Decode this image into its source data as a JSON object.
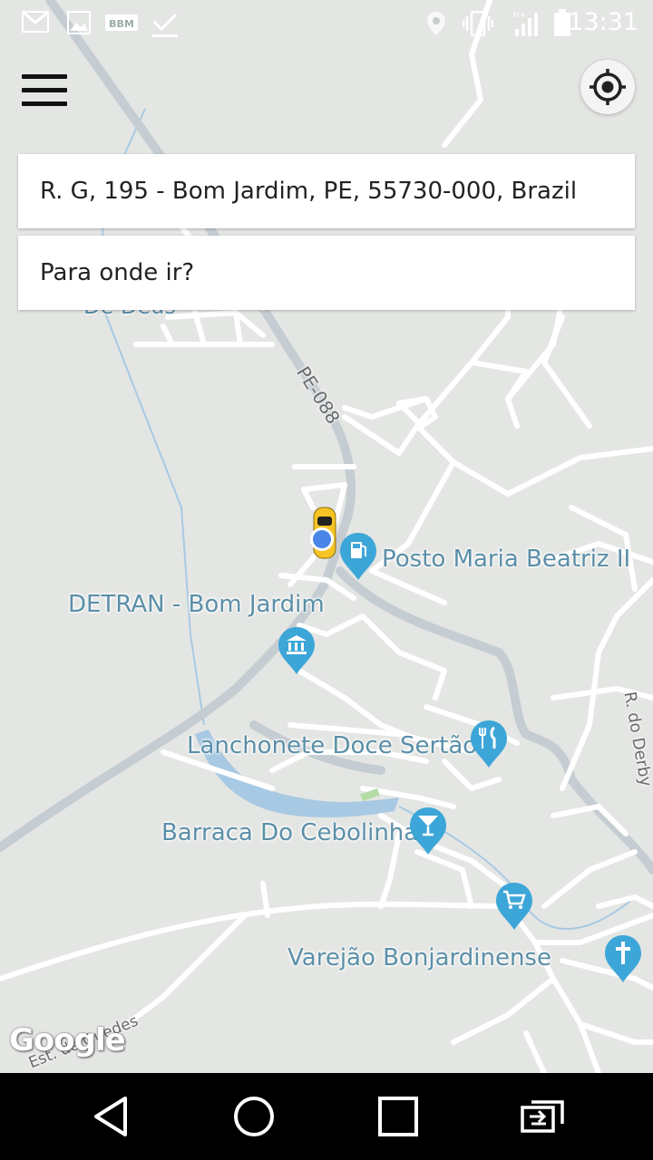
{
  "status_bar": {
    "time": "13:31",
    "icons": [
      "gmail-icon",
      "image-icon",
      "bbm-icon",
      "download-done-icon",
      "location-icon",
      "vibrate-icon",
      "signal-icon",
      "battery-icon"
    ]
  },
  "search": {
    "pickup_address": "R. G, 195 - Bom Jardim, PE, 55730-000, Brazil",
    "destination_placeholder": "Para onde ir?"
  },
  "map": {
    "roads": [
      {
        "name": "PE-088"
      },
      {
        "name": "R. do Derby"
      },
      {
        "name": "Est. de Guedes"
      },
      {
        "name": "De Deus"
      }
    ],
    "places": [
      {
        "name": "Posto Maria Beatriz II",
        "icon": "gas-station-icon"
      },
      {
        "name": "DETRAN - Bom Jardim",
        "icon": "government-building-icon"
      },
      {
        "name": "Lanchonete Doce Sertão",
        "icon": "restaurant-icon"
      },
      {
        "name": "Barraca Do Cebolinha",
        "icon": "bar-icon"
      },
      {
        "name": "Varejão Bonjardinense",
        "icon": "shopping-cart-icon"
      },
      {
        "name": "",
        "icon": "church-icon"
      }
    ],
    "attribution": "Google"
  },
  "colors": {
    "map_bg": "#e4e6e3",
    "road": "#ffffff",
    "highway": "#c5cdd3",
    "water": "#a8c9e3",
    "pin": "#3da6d8",
    "user_dot": "#4a86e8",
    "taxi": "#f6c324"
  },
  "nav_bar": [
    "back-icon",
    "home-icon",
    "recents-icon",
    "switch-app-icon"
  ]
}
